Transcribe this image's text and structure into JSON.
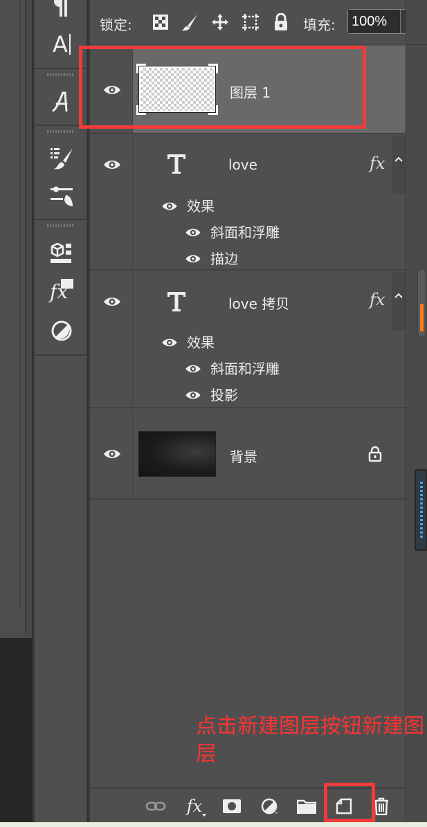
{
  "lock_bar": {
    "lock_label": "锁定:",
    "fill_label": "填充:",
    "fill_value": "100%"
  },
  "layers": [
    {
      "name": "图层 1",
      "type": "pixel",
      "selected": true,
      "highlighted": true
    },
    {
      "name": "love",
      "type": "text",
      "fx": "fx",
      "effects_label": "效果",
      "effects": [
        "斜面和浮雕",
        "描边"
      ]
    },
    {
      "name": "love 拷贝",
      "type": "text",
      "fx": "fx",
      "effects_label": "效果",
      "effects": [
        "斜面和浮雕",
        "投影"
      ]
    },
    {
      "name": "背景",
      "type": "background",
      "locked": true
    }
  ],
  "bottom_toolbar": {
    "icons": [
      "link-icon",
      "fx-icon",
      "mask-icon",
      "adjustment-icon",
      "folder-icon",
      "new-layer-icon",
      "trash-icon"
    ],
    "fx_text": "fx",
    "highlighted": "new-layer-icon"
  },
  "annotation": {
    "text": "点击新建图层按钮新建图层"
  },
  "tools": {
    "text_tool_label": "A",
    "fx_tool_label": "fx"
  },
  "colors": {
    "panel_bg": "#4f4f4f",
    "selected_row": "#696969",
    "highlight_red": "#f23b3b",
    "scroll_accent": "#ff7a1a"
  }
}
